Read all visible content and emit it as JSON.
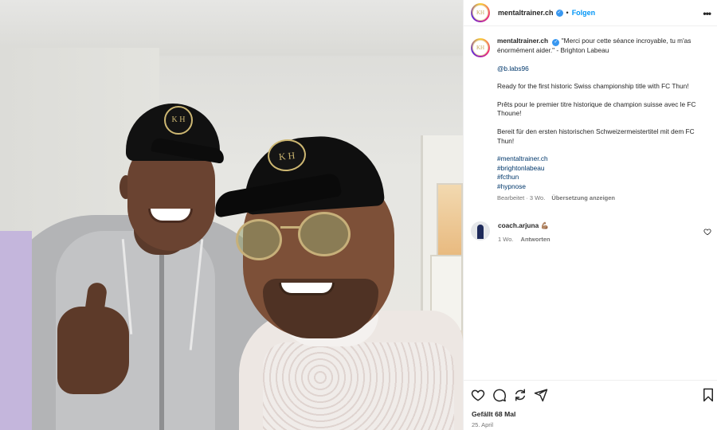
{
  "post": {
    "author": "mentaltrainer.ch",
    "author_logo": "KH",
    "follow_label": "Folgen",
    "more_icon": "more-horizontal-icon"
  },
  "caption": {
    "author": "mentaltrainer.ch",
    "quote": "\"Merci pour cette séance incroyable, tu m'as énormément aider.\" - Brighton Labeau",
    "mention": "@b.labs96",
    "paragraphs": [
      "Ready for the first historic Swiss championship title with FC Thun!",
      "Prêts pour le premier titre historique de champion suisse avec le FC Thoune!",
      "Bereit für den ersten historischen Schweizermeistertitel mit dem FC Thun!"
    ],
    "hashtags": [
      "#mentaltrainer.ch",
      "#brightonlabeau",
      "#fcthun",
      "#hypnose"
    ],
    "edited": "Bearbeitet · 3 Wo.",
    "translate_label": "Übersetzung anzeigen"
  },
  "comment": {
    "author": "coach.arjuna",
    "text": "💪🏽",
    "time": "1 Wo.",
    "reply_label": "Antworten"
  },
  "actions": {
    "likes": "Gefällt 68 Mal",
    "date": "25. April"
  },
  "colors": {
    "link": "#00376b",
    "follow": "#0095f6",
    "meta": "#737373"
  }
}
